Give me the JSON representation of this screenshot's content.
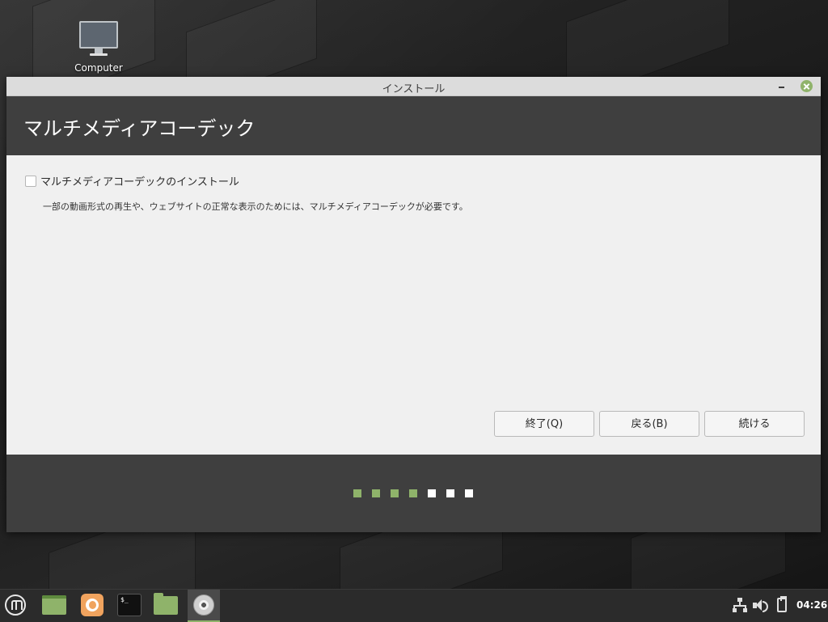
{
  "desktop": {
    "icons": [
      {
        "label": "Computer",
        "icon": "computer-icon"
      }
    ]
  },
  "window": {
    "title": "インストール",
    "heading": "マルチメディアコーデック",
    "option": {
      "label": "マルチメディアコーデックのインストール",
      "checked": false,
      "description": "一部の動画形式の再生や、ウェブサイトの正常な表示のためには、マルチメディアコーデックが必要です。"
    },
    "buttons": {
      "quit": "終了(Q)",
      "back": "戻る(B)",
      "next": "続ける"
    },
    "progress": {
      "total_steps": 7,
      "completed_steps": 4
    }
  },
  "colors": {
    "accent": "#8fb36a",
    "header_band": "#3f3f3f",
    "content_bg": "#f0f0f0",
    "titlebar_bg": "#dcdcdc",
    "taskbar_bg": "#2b2b2b"
  },
  "taskbar": {
    "launchers": [
      {
        "icon": "mint-menu-icon"
      },
      {
        "icon": "show-desktop-icon"
      },
      {
        "icon": "firefox-icon"
      },
      {
        "icon": "terminal-icon",
        "glyph": "$_"
      },
      {
        "icon": "file-manager-icon"
      },
      {
        "icon": "installer-disc-icon",
        "active": true
      }
    ],
    "tray": [
      {
        "icon": "network-icon"
      },
      {
        "icon": "volume-icon"
      },
      {
        "icon": "clipboard-icon"
      }
    ],
    "clock": "04:26"
  }
}
